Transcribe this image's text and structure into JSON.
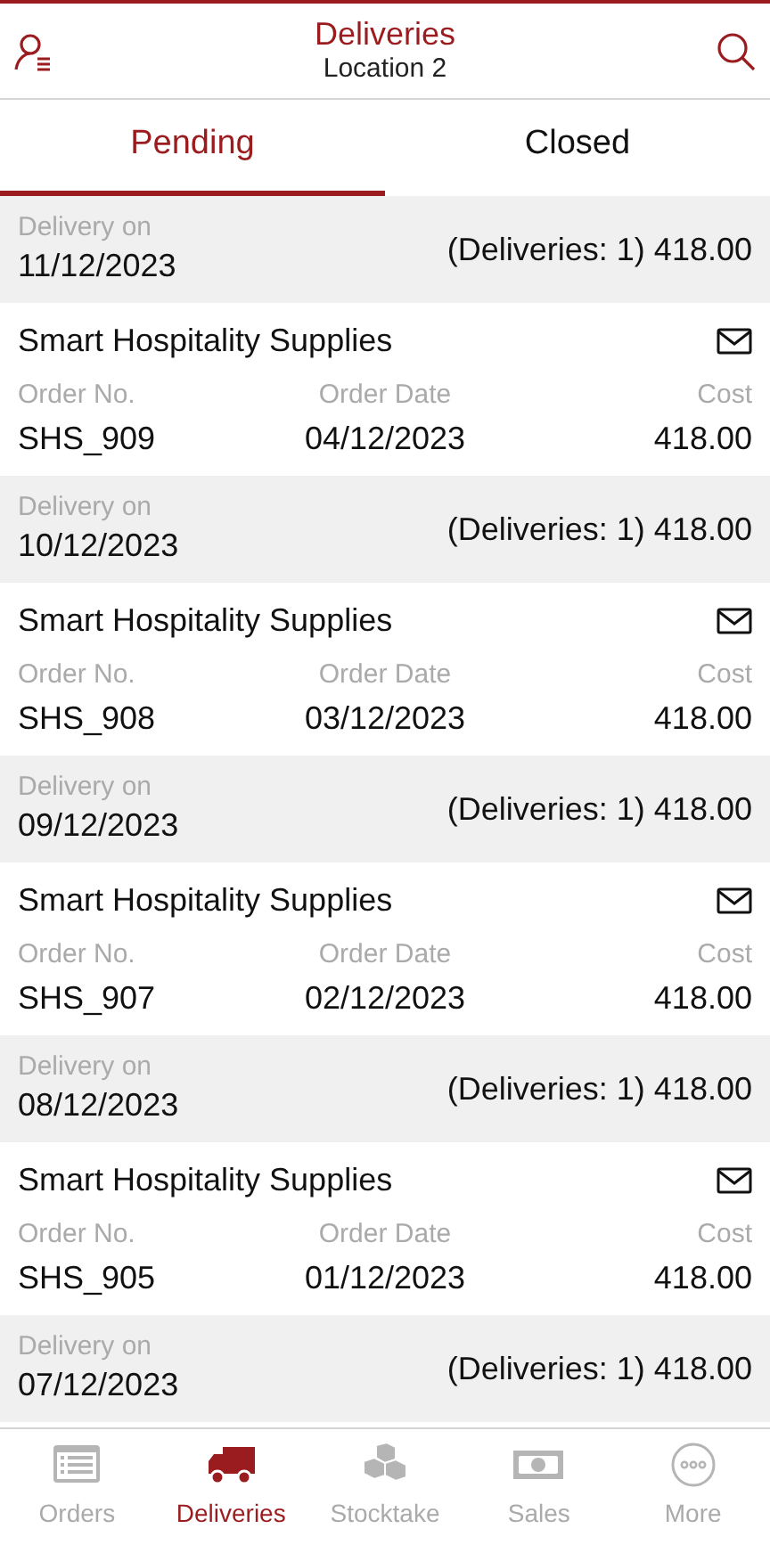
{
  "header": {
    "title": "Deliveries",
    "subtitle": "Location 2"
  },
  "tabs": [
    {
      "label": "Pending",
      "selected": true
    },
    {
      "label": "Closed",
      "selected": false
    }
  ],
  "groups": [
    {
      "label": "Delivery on",
      "date": "11/12/2023",
      "summary": "(Deliveries: 1) 418.00",
      "orders": [
        {
          "supplier": "Smart Hospitality Supplies",
          "no_label": "Order No.",
          "no": "SHS_909",
          "date_label": "Order Date",
          "date": "04/12/2023",
          "cost_label": "Cost",
          "cost": "418.00"
        }
      ]
    },
    {
      "label": "Delivery on",
      "date": "10/12/2023",
      "summary": "(Deliveries: 1) 418.00",
      "orders": [
        {
          "supplier": "Smart Hospitality Supplies",
          "no_label": "Order No.",
          "no": "SHS_908",
          "date_label": "Order Date",
          "date": "03/12/2023",
          "cost_label": "Cost",
          "cost": "418.00"
        }
      ]
    },
    {
      "label": "Delivery on",
      "date": "09/12/2023",
      "summary": "(Deliveries: 1) 418.00",
      "orders": [
        {
          "supplier": "Smart Hospitality Supplies",
          "no_label": "Order No.",
          "no": "SHS_907",
          "date_label": "Order Date",
          "date": "02/12/2023",
          "cost_label": "Cost",
          "cost": "418.00"
        }
      ]
    },
    {
      "label": "Delivery on",
      "date": "08/12/2023",
      "summary": "(Deliveries: 1) 418.00",
      "orders": [
        {
          "supplier": "Smart Hospitality Supplies",
          "no_label": "Order No.",
          "no": "SHS_905",
          "date_label": "Order Date",
          "date": "01/12/2023",
          "cost_label": "Cost",
          "cost": "418.00"
        }
      ]
    },
    {
      "label": "Delivery on",
      "date": "07/12/2023",
      "summary": "(Deliveries: 1) 418.00"
    }
  ],
  "nav": [
    {
      "kind": "orders",
      "label": "Orders",
      "selected": false
    },
    {
      "kind": "deliveries",
      "label": "Deliveries",
      "selected": true
    },
    {
      "kind": "stocktake",
      "label": "Stocktake",
      "selected": false
    },
    {
      "kind": "sales",
      "label": "Sales",
      "selected": false
    },
    {
      "kind": "more",
      "label": "More",
      "selected": false
    }
  ]
}
